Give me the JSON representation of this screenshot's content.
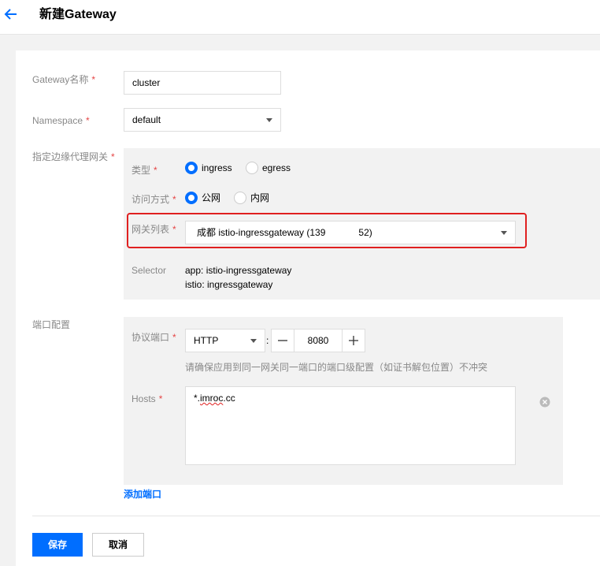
{
  "header": {
    "title": "新建Gateway"
  },
  "form": {
    "name_label": "Gateway名称",
    "name_value": "cluster",
    "namespace_label": "Namespace",
    "namespace_value": "default",
    "edge_gateway_label": "指定边缘代理网关",
    "type_label": "类型",
    "type_options": [
      "ingress",
      "egress"
    ],
    "type_selected": "ingress",
    "access_label": "访问方式",
    "access_options": [
      "公网",
      "内网"
    ],
    "access_selected": "公网",
    "gateway_list_label": "网关列表",
    "gateway_list_value_pre": "成都 istio-ingressgateway (139",
    "gateway_list_value_post": "52)",
    "selector_label": "Selector",
    "selector_lines": [
      "app: istio-ingressgateway",
      "istio: ingressgateway"
    ],
    "port_config_label": "端口配置",
    "protocol_port_label": "协议端口",
    "protocol_value": "HTTP",
    "port_separator": ":",
    "port_value": "8080",
    "minus_label": "—",
    "plus_label": "+",
    "port_hint": "请确保应用到同一网关同一端口的端口级配置（如证书解包位置）不冲突",
    "hosts_label": "Hosts",
    "hosts_value_prefix": "*.",
    "hosts_value_word": "imroc",
    "hosts_value_suffix": ".cc",
    "add_port_label": "添加端口",
    "required_mark": "*"
  },
  "footer": {
    "save_label": "保存",
    "cancel_label": "取消"
  },
  "colors": {
    "accent": "#006eff",
    "required": "#e54545",
    "highlight": "#e02020"
  }
}
